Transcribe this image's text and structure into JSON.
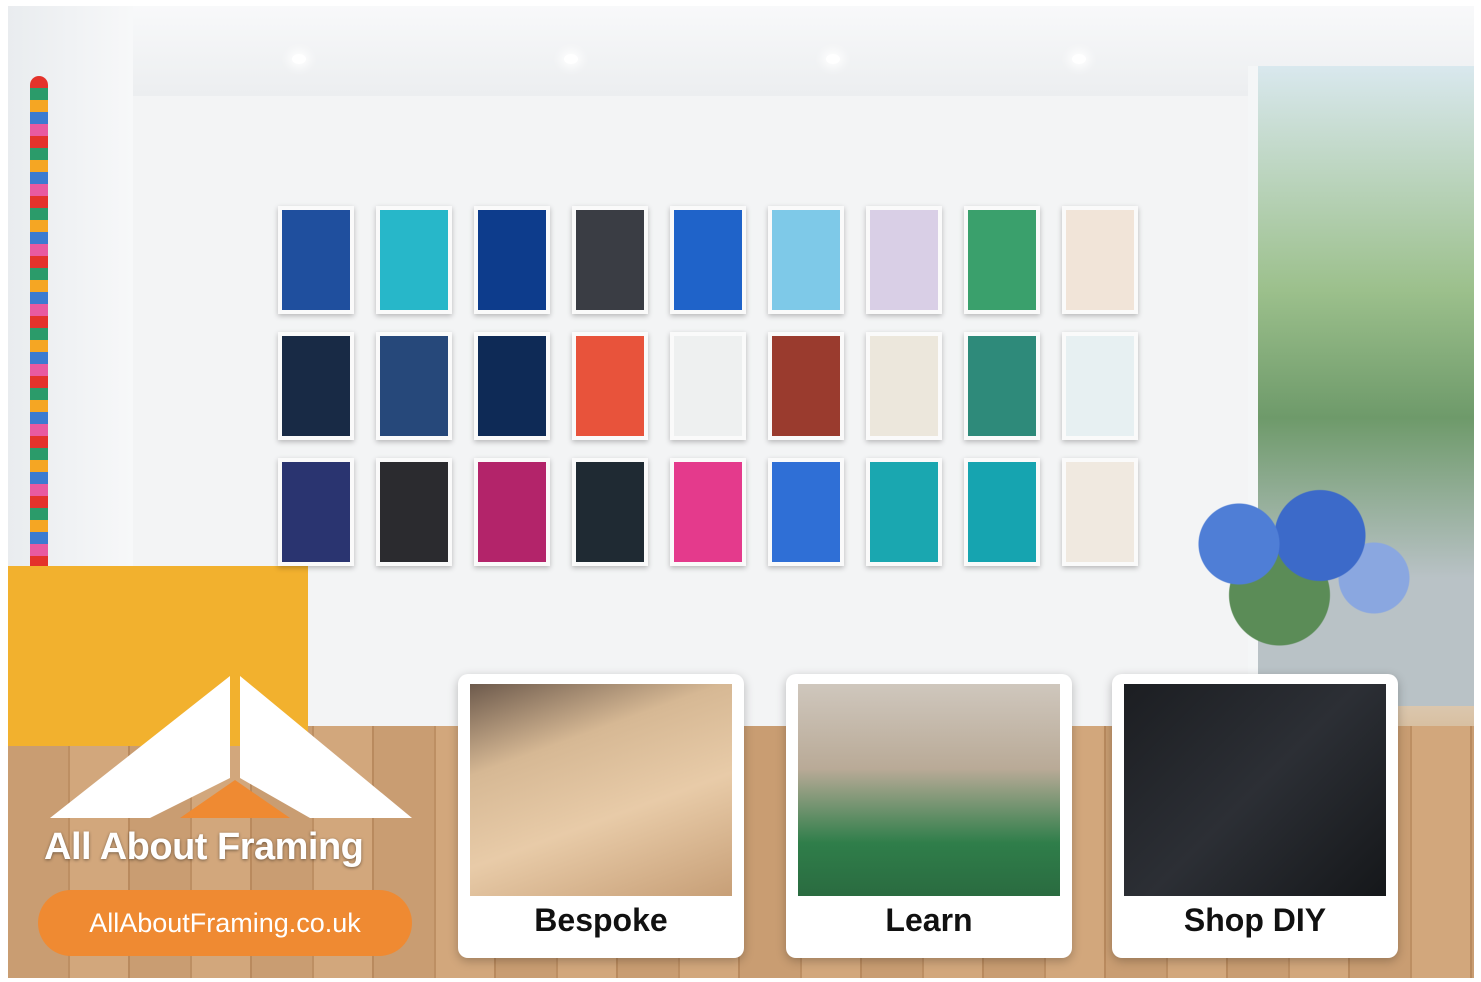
{
  "brand": {
    "name": "All About Framing",
    "website": "AllAboutFraming.co.uk",
    "accent_color": "#ef8a32",
    "logo_icon": "roof-frame-logo"
  },
  "cards": [
    {
      "label": "Bespoke",
      "image": "framing-workbench-photo"
    },
    {
      "label": "Learn",
      "image": "framing-class-photo"
    },
    {
      "label": "Shop DIY",
      "image": "diy-framing-tools-photo"
    }
  ],
  "background": {
    "image": "framing-gallery-shop-interior",
    "poster_colors": [
      "#1f4f9e",
      "#27b7c9",
      "#0d3c8c",
      "#3a3d44",
      "#1f63c9",
      "#7ec9e8",
      "#d9cfe6",
      "#3aa06c",
      "#f1e4d8",
      "#182a45",
      "#26487a",
      "#0e2a56",
      "#e8533b",
      "#eef0f0",
      "#9a3b2e",
      "#ece7dc",
      "#2e8a7a",
      "#e7f0f2",
      "#2a3470",
      "#2b2b2f",
      "#b3246a",
      "#1f2a33",
      "#e43a8c",
      "#2f6fd6",
      "#1aa7b0",
      "#16a4b0",
      "#f0e9e0"
    ]
  }
}
